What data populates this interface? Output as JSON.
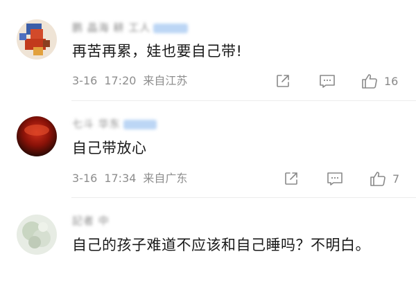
{
  "comments": [
    {
      "username": "鹏 晶海 耕 工人",
      "text": "再苦再累，娃也要自己带!",
      "date": "3-16",
      "time": "17:20",
      "location": "来自江苏",
      "likes": "16"
    },
    {
      "username": "七斗 华东",
      "text": "自己带放心",
      "date": "3-16",
      "time": "17:34",
      "location": "来自广东",
      "likes": "7"
    },
    {
      "username": "記者 中",
      "text": "自己的孩子难道不应该和自己睡吗？不明白。"
    }
  ],
  "icons": {
    "share": "share-icon",
    "comment": "comment-icon",
    "like": "thumbs-up-icon"
  },
  "colors": {
    "text": "#1a1a1a",
    "meta": "#8d8d8d",
    "vip_badge": "#bcd6f5"
  }
}
